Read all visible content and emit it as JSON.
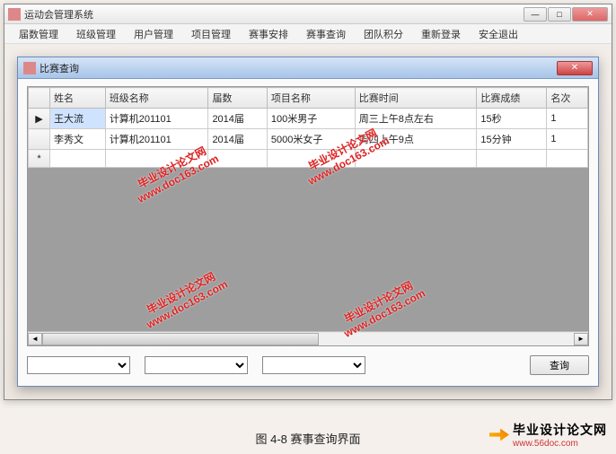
{
  "outer_window": {
    "title": "运动会管理系统"
  },
  "menu": {
    "items": [
      "届数管理",
      "班级管理",
      "用户管理",
      "项目管理",
      "赛事安排",
      "赛事查询",
      "团队积分",
      "重新登录",
      "安全退出"
    ]
  },
  "child_window": {
    "title": "比赛查询"
  },
  "grid": {
    "headers": [
      "",
      "姓名",
      "班级名称",
      "届数",
      "项目名称",
      "比赛时间",
      "比赛成绩",
      "名次"
    ],
    "rows": [
      {
        "marker": "▶",
        "name": "王大流",
        "class": "计算机201101",
        "term": "2014届",
        "event": "100米男子",
        "time": "周三上午8点左右",
        "result": "15秒",
        "rank": "1"
      },
      {
        "marker": "",
        "name": "李秀文",
        "class": "计算机201101",
        "term": "2014届",
        "event": "5000米女子",
        "time": "周四上午9点",
        "result": "15分钟",
        "rank": "1"
      }
    ],
    "new_row_marker": "*"
  },
  "filters": {
    "combo1": "",
    "combo2": "",
    "combo3": "",
    "query_button": "查询"
  },
  "caption": "图 4-8  赛事查询界面",
  "watermark": {
    "line1": "毕业设计论文网",
    "line2": "www.doc163.com"
  },
  "footer": {
    "brand": "毕业设计论文网",
    "url": "www.56doc.com"
  }
}
